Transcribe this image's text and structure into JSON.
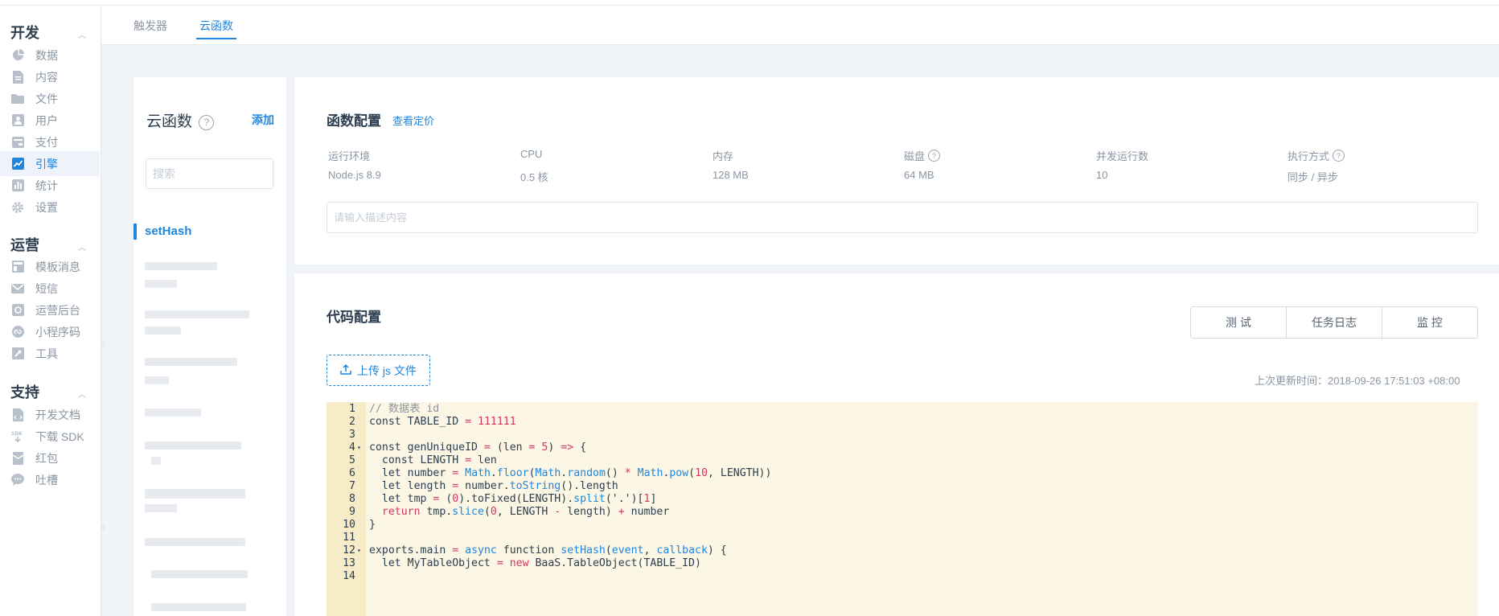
{
  "sidebar": {
    "sections": [
      {
        "title": "开发",
        "items": [
          {
            "label": "数据",
            "icon": "pie-chart-icon"
          },
          {
            "label": "内容",
            "icon": "document-icon"
          },
          {
            "label": "文件",
            "icon": "folder-icon"
          },
          {
            "label": "用户",
            "icon": "user-icon"
          },
          {
            "label": "支付",
            "icon": "wallet-icon"
          },
          {
            "label": "引擎",
            "icon": "engine-chart-icon",
            "active": true
          },
          {
            "label": "统计",
            "icon": "bar-chart-icon"
          },
          {
            "label": "设置",
            "icon": "gear-icon"
          }
        ]
      },
      {
        "title": "运营",
        "items": [
          {
            "label": "模板消息",
            "icon": "template-icon"
          },
          {
            "label": "短信",
            "icon": "mail-icon"
          },
          {
            "label": "运营后台",
            "icon": "console-icon"
          },
          {
            "label": "小程序码",
            "icon": "miniprogram-icon"
          },
          {
            "label": "工具",
            "icon": "wrench-icon"
          }
        ]
      },
      {
        "title": "支持",
        "items": [
          {
            "label": "开发文档",
            "icon": "docs-icon"
          },
          {
            "label": "下载 SDK",
            "icon": "sdk-icon"
          },
          {
            "label": "红包",
            "icon": "red-packet-icon"
          },
          {
            "label": "吐槽",
            "icon": "chat-bubble-icon"
          }
        ]
      }
    ]
  },
  "header": {
    "tabs": [
      {
        "label": "触发器",
        "active": false
      },
      {
        "label": "云函数",
        "active": true
      }
    ]
  },
  "functions": {
    "title": "云函数",
    "add_label": "添加",
    "search_placeholder": "搜索",
    "active_item": "setHash"
  },
  "config": {
    "title": "函数配置",
    "pricing_link": "查看定价",
    "specs": [
      {
        "label": "运行环境",
        "value": "Node.js 8.9",
        "help": false
      },
      {
        "label": "CPU",
        "value": "0.5 核",
        "help": false
      },
      {
        "label": "内存",
        "value": "128 MB",
        "help": false
      },
      {
        "label": "磁盘",
        "value": "64 MB",
        "help": true
      },
      {
        "label": "并发运行数",
        "value": "10",
        "help": false
      },
      {
        "label": "执行方式",
        "value": "同步 / 异步",
        "help": true
      }
    ],
    "description_placeholder": "请输入描述内容"
  },
  "code_config": {
    "title": "代码配置",
    "buttons": [
      "测 试",
      "任务日志",
      "监 控"
    ],
    "upload_label": "上传 js 文件",
    "updated_text": "上次更新时间：2018-09-26 17:51:03 +08:00"
  },
  "code": {
    "lines": [
      {
        "n": "1",
        "fold": false,
        "tokens": [
          [
            "comment",
            "// 数据表 id"
          ]
        ]
      },
      {
        "n": "2",
        "fold": false,
        "tokens": [
          [
            "kw",
            "const"
          ],
          [
            "plain",
            " TABLE_ID "
          ],
          [
            "op",
            "="
          ],
          [
            "plain",
            " "
          ],
          [
            "num",
            "111111"
          ]
        ]
      },
      {
        "n": "3",
        "fold": false,
        "tokens": []
      },
      {
        "n": "4",
        "fold": true,
        "tokens": [
          [
            "kw",
            "const"
          ],
          [
            "plain",
            " genUniqueID "
          ],
          [
            "op",
            "="
          ],
          [
            "plain",
            " (len "
          ],
          [
            "op",
            "="
          ],
          [
            "plain",
            " "
          ],
          [
            "num",
            "5"
          ],
          [
            "plain",
            ") "
          ],
          [
            "op",
            "=>"
          ],
          [
            "plain",
            " {"
          ]
        ]
      },
      {
        "n": "5",
        "fold": false,
        "tokens": [
          [
            "plain",
            "  "
          ],
          [
            "kw",
            "const"
          ],
          [
            "plain",
            " LENGTH "
          ],
          [
            "op",
            "="
          ],
          [
            "plain",
            " len"
          ]
        ]
      },
      {
        "n": "6",
        "fold": false,
        "tokens": [
          [
            "plain",
            "  "
          ],
          [
            "kw",
            "let"
          ],
          [
            "plain",
            " number "
          ],
          [
            "op",
            "="
          ],
          [
            "plain",
            " "
          ],
          [
            "fn",
            "Math"
          ],
          [
            "plain",
            "."
          ],
          [
            "fn",
            "floor"
          ],
          [
            "plain",
            "("
          ],
          [
            "fn",
            "Math"
          ],
          [
            "plain",
            "."
          ],
          [
            "fn",
            "random"
          ],
          [
            "plain",
            "() "
          ],
          [
            "op",
            "*"
          ],
          [
            "plain",
            " "
          ],
          [
            "fn",
            "Math"
          ],
          [
            "plain",
            "."
          ],
          [
            "fn",
            "pow"
          ],
          [
            "plain",
            "("
          ],
          [
            "num",
            "10"
          ],
          [
            "plain",
            ", LENGTH))"
          ]
        ]
      },
      {
        "n": "7",
        "fold": false,
        "tokens": [
          [
            "plain",
            "  "
          ],
          [
            "kw",
            "let"
          ],
          [
            "plain",
            " length "
          ],
          [
            "op",
            "="
          ],
          [
            "plain",
            " number."
          ],
          [
            "fn",
            "toString"
          ],
          [
            "plain",
            "().length"
          ]
        ]
      },
      {
        "n": "8",
        "fold": false,
        "tokens": [
          [
            "plain",
            "  "
          ],
          [
            "kw",
            "let"
          ],
          [
            "plain",
            " tmp "
          ],
          [
            "op",
            "="
          ],
          [
            "plain",
            " ("
          ],
          [
            "num",
            "0"
          ],
          [
            "plain",
            ").toFixed(LENGTH)."
          ],
          [
            "fn",
            "split"
          ],
          [
            "plain",
            "('.')["
          ],
          [
            "num",
            "1"
          ],
          [
            "plain",
            "]"
          ]
        ]
      },
      {
        "n": "9",
        "fold": false,
        "tokens": [
          [
            "plain",
            "  "
          ],
          [
            "op",
            "return"
          ],
          [
            "plain",
            " tmp."
          ],
          [
            "fn",
            "slice"
          ],
          [
            "plain",
            "("
          ],
          [
            "num",
            "0"
          ],
          [
            "plain",
            ", LENGTH "
          ],
          [
            "op",
            "-"
          ],
          [
            "plain",
            " length) "
          ],
          [
            "op",
            "+"
          ],
          [
            "plain",
            " number"
          ]
        ]
      },
      {
        "n": "10",
        "fold": false,
        "tokens": [
          [
            "plain",
            "}"
          ]
        ]
      },
      {
        "n": "11",
        "fold": false,
        "tokens": []
      },
      {
        "n": "12",
        "fold": true,
        "tokens": [
          [
            "plain",
            "exports.main "
          ],
          [
            "op",
            "="
          ],
          [
            "plain",
            " "
          ],
          [
            "kw2",
            "async"
          ],
          [
            "plain",
            " "
          ],
          [
            "kw",
            "function"
          ],
          [
            "plain",
            " "
          ],
          [
            "def",
            "setHash"
          ],
          [
            "plain",
            "("
          ],
          [
            "def",
            "event"
          ],
          [
            "plain",
            ", "
          ],
          [
            "def",
            "callback"
          ],
          [
            "plain",
            ") {"
          ]
        ]
      },
      {
        "n": "13",
        "fold": false,
        "tokens": [
          [
            "plain",
            "  "
          ],
          [
            "kw",
            "let"
          ],
          [
            "plain",
            " MyTableObject "
          ],
          [
            "op",
            "="
          ],
          [
            "plain",
            " "
          ],
          [
            "op",
            "new"
          ],
          [
            "plain",
            " BaaS.TableObject(TABLE_ID)"
          ]
        ]
      },
      {
        "n": "14",
        "fold": false,
        "tokens": []
      }
    ]
  }
}
